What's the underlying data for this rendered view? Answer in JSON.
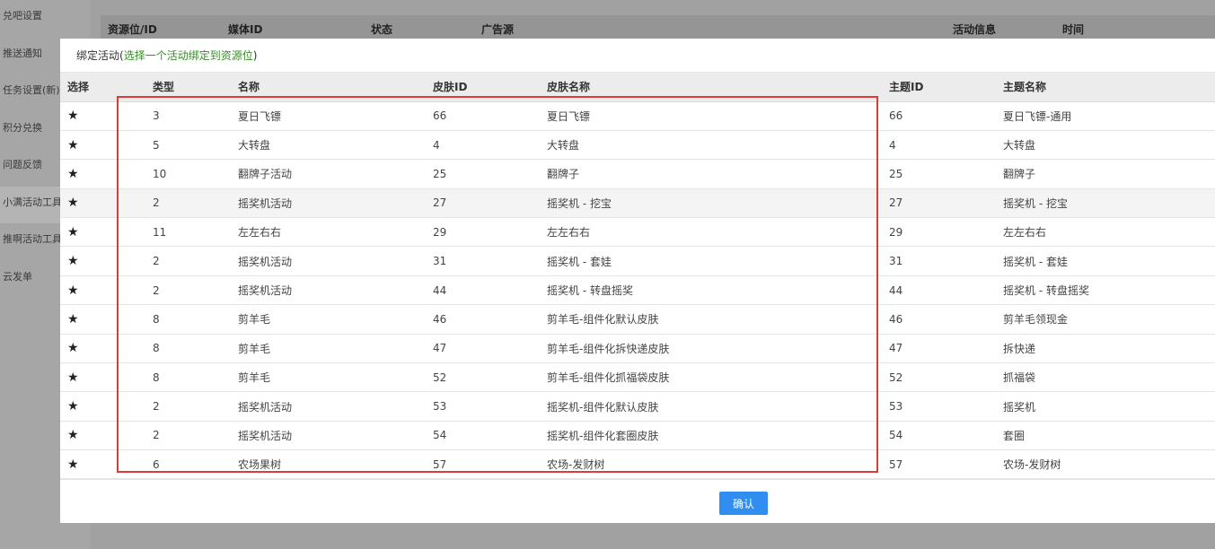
{
  "sidebar": {
    "items": [
      {
        "label": "兑吧设置"
      },
      {
        "label": "推送通知"
      },
      {
        "label": "任务设置(新)"
      },
      {
        "label": "积分兑换"
      },
      {
        "label": "问题反馈"
      },
      {
        "label": "小满活动工具"
      },
      {
        "label": "推啊活动工具"
      },
      {
        "label": "云发单"
      }
    ]
  },
  "background_table": {
    "headers": [
      "资源位/ID",
      "媒体ID",
      "状态",
      "广告源",
      "活动信息",
      "时间"
    ]
  },
  "modal": {
    "title": "绑定活动(",
    "hint": "选择一个活动绑定到资源位",
    "title_end": ")",
    "columns": [
      "选择",
      "类型",
      "名称",
      "皮肤ID",
      "皮肤名称",
      "主题ID",
      "主题名称"
    ],
    "star_icon": "★",
    "rows": [
      {
        "type": "3",
        "name": "夏日飞镖",
        "skin_id": "66",
        "skin_name": "夏日飞镖",
        "theme_id": "66",
        "theme_name": "夏日飞镖-通用"
      },
      {
        "type": "5",
        "name": "大转盘",
        "skin_id": "4",
        "skin_name": "大转盘",
        "theme_id": "4",
        "theme_name": "大转盘"
      },
      {
        "type": "10",
        "name": "翻牌子活动",
        "skin_id": "25",
        "skin_name": "翻牌子",
        "theme_id": "25",
        "theme_name": "翻牌子"
      },
      {
        "type": "2",
        "name": "摇奖机活动",
        "skin_id": "27",
        "skin_name": "摇奖机 - 挖宝",
        "theme_id": "27",
        "theme_name": "摇奖机 - 挖宝"
      },
      {
        "type": "11",
        "name": "左左右右",
        "skin_id": "29",
        "skin_name": "左左右右",
        "theme_id": "29",
        "theme_name": "左左右右"
      },
      {
        "type": "2",
        "name": "摇奖机活动",
        "skin_id": "31",
        "skin_name": "摇奖机 - 套娃",
        "theme_id": "31",
        "theme_name": "摇奖机 - 套娃"
      },
      {
        "type": "2",
        "name": "摇奖机活动",
        "skin_id": "44",
        "skin_name": "摇奖机 - 转盘摇奖",
        "theme_id": "44",
        "theme_name": "摇奖机 - 转盘摇奖"
      },
      {
        "type": "8",
        "name": "剪羊毛",
        "skin_id": "46",
        "skin_name": "剪羊毛-组件化默认皮肤",
        "theme_id": "46",
        "theme_name": "剪羊毛领现金"
      },
      {
        "type": "8",
        "name": "剪羊毛",
        "skin_id": "47",
        "skin_name": "剪羊毛-组件化拆快递皮肤",
        "theme_id": "47",
        "theme_name": "拆快递"
      },
      {
        "type": "8",
        "name": "剪羊毛",
        "skin_id": "52",
        "skin_name": "剪羊毛-组件化抓福袋皮肤",
        "theme_id": "52",
        "theme_name": "抓福袋"
      },
      {
        "type": "2",
        "name": "摇奖机活动",
        "skin_id": "53",
        "skin_name": "摇奖机-组件化默认皮肤",
        "theme_id": "53",
        "theme_name": "摇奖机"
      },
      {
        "type": "2",
        "name": "摇奖机活动",
        "skin_id": "54",
        "skin_name": "摇奖机-组件化套圈皮肤",
        "theme_id": "54",
        "theme_name": "套圈"
      },
      {
        "type": "6",
        "name": "农场果树",
        "skin_id": "57",
        "skin_name": "农场-发财树",
        "theme_id": "57",
        "theme_name": "农场-发财树"
      }
    ],
    "confirm_label": "确认"
  },
  "colors": {
    "confirm_button": "#2f8ef0",
    "highlight_box": "#e03a3a",
    "hint_text": "#3a8a2a"
  }
}
